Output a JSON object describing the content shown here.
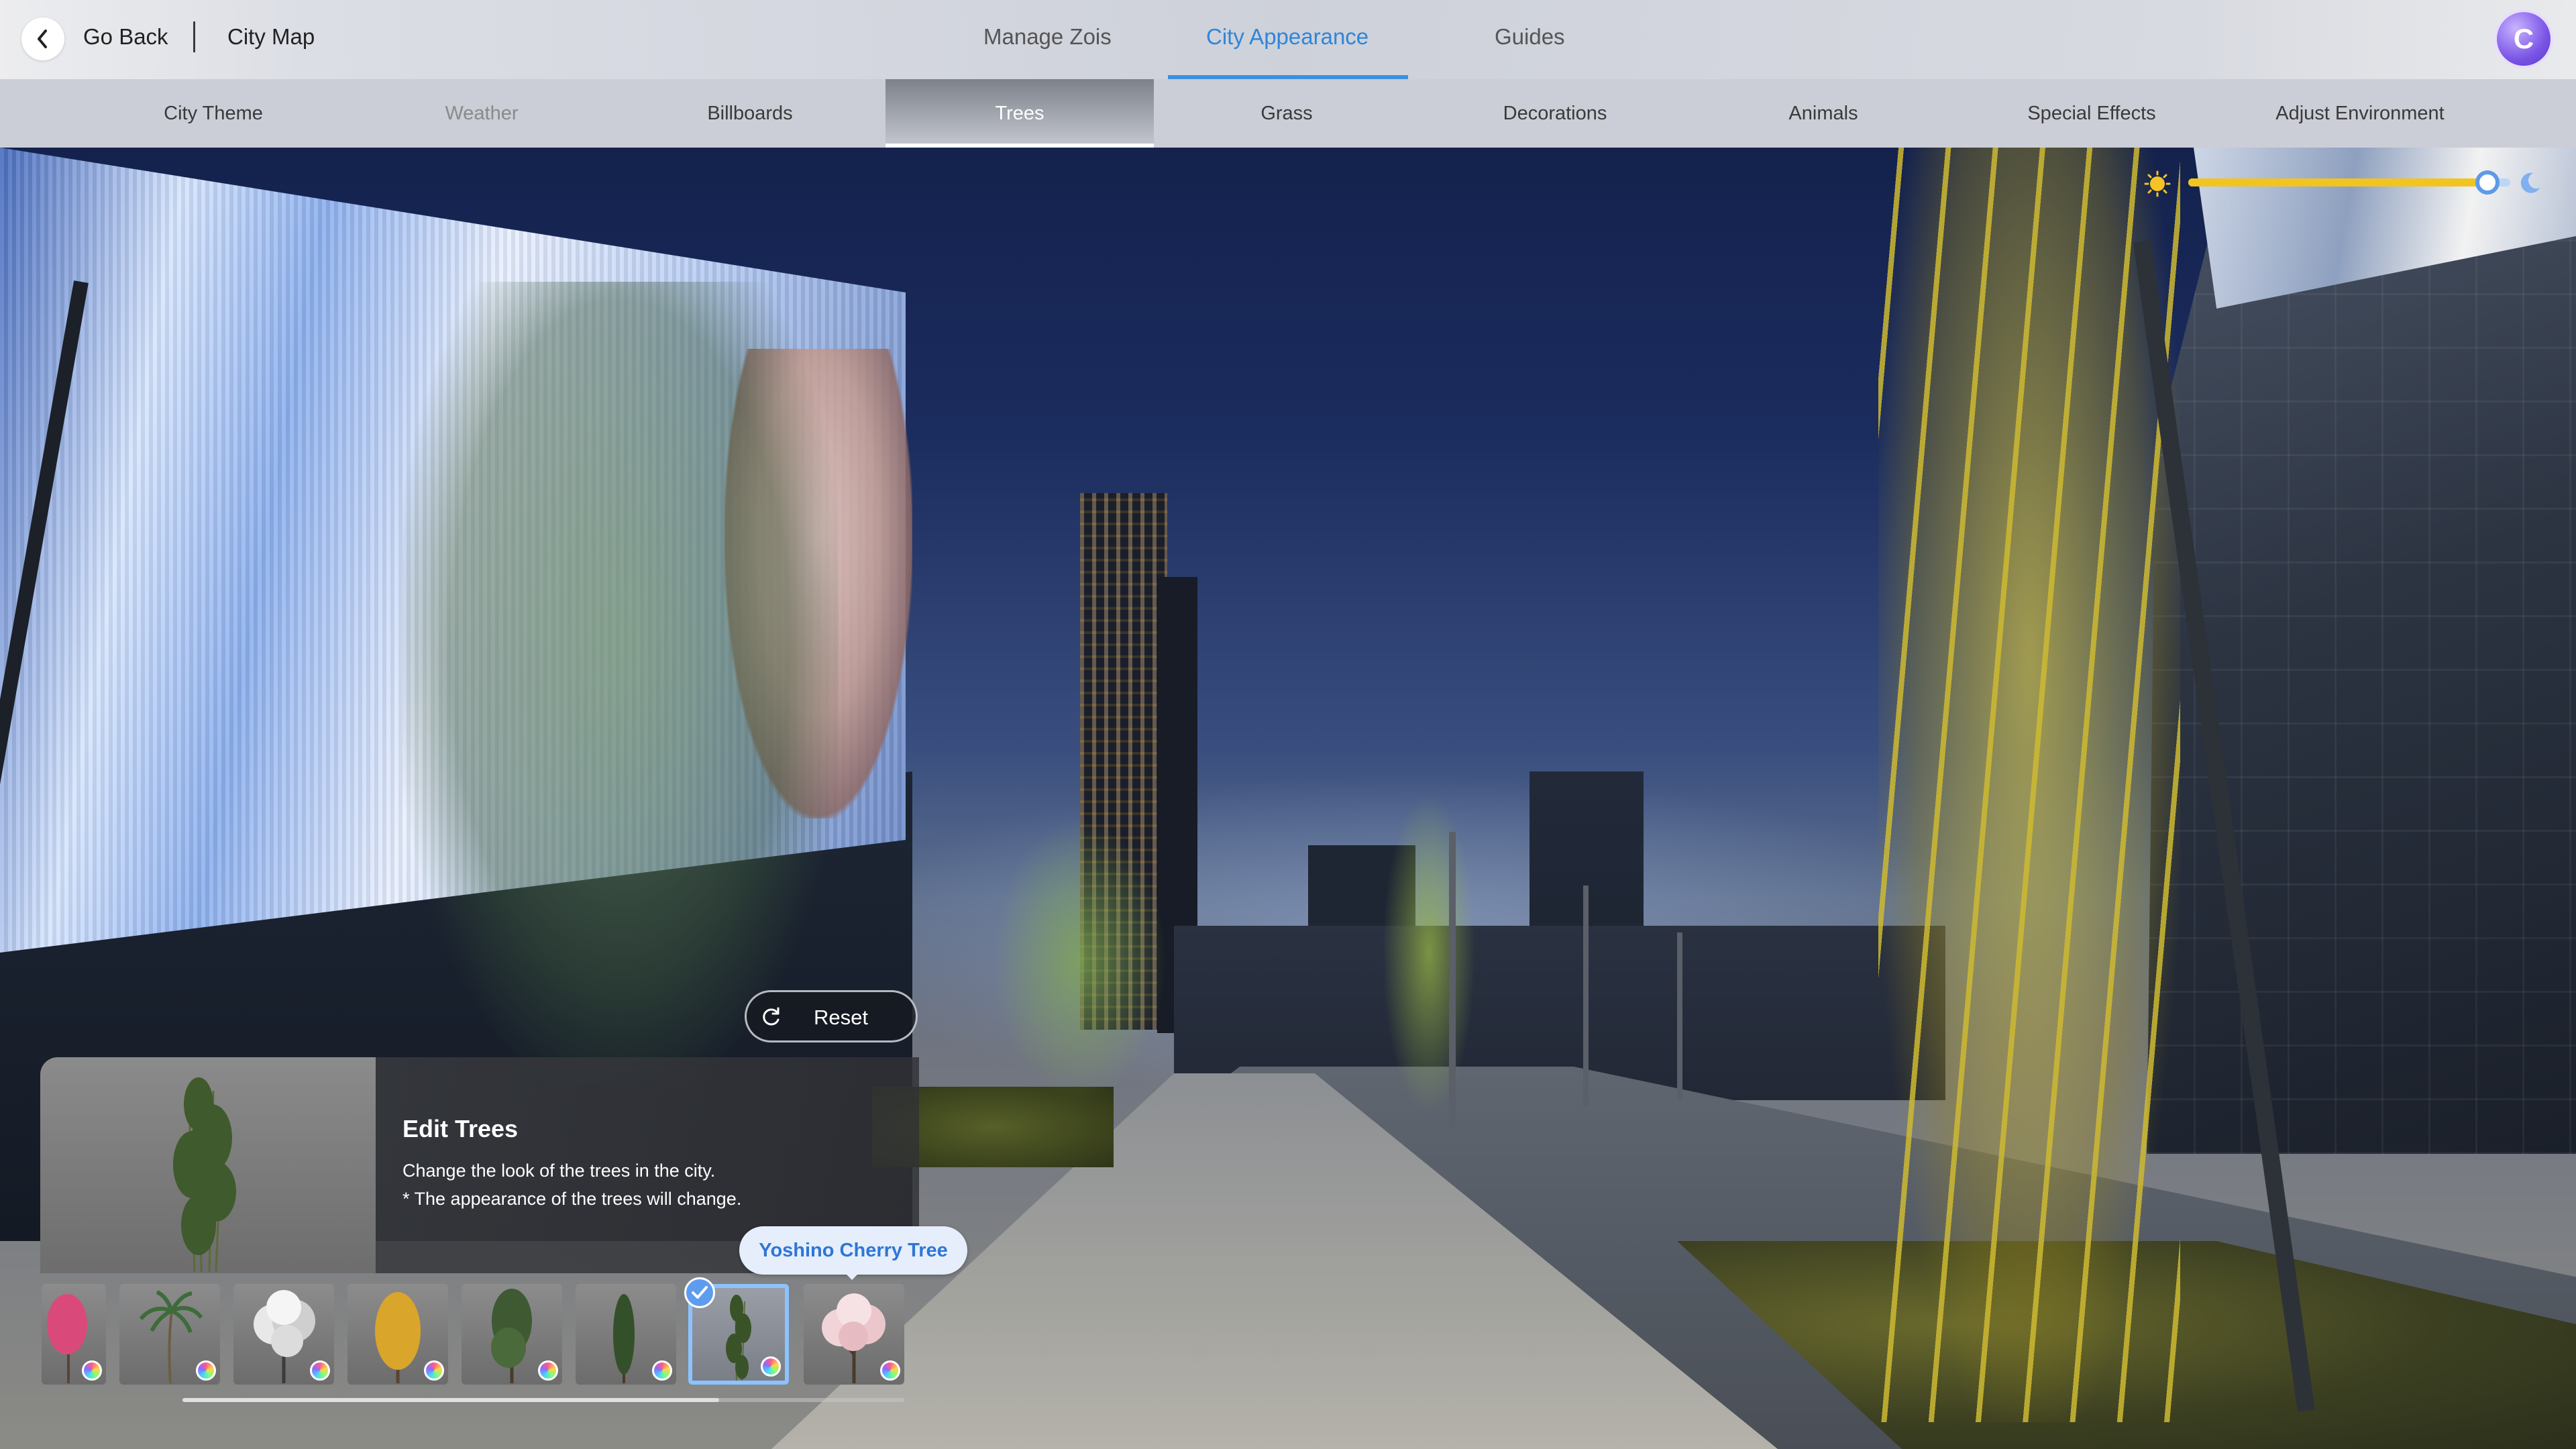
{
  "header": {
    "back_label": "Go Back",
    "breadcrumb": "City Map",
    "tabs": [
      {
        "label": "Manage Zois",
        "active": false
      },
      {
        "label": "City Appearance",
        "active": true
      },
      {
        "label": "Guides",
        "active": false
      }
    ],
    "avatar_letter": "C",
    "accent_color": "#2f86d8"
  },
  "subtabs": [
    {
      "label": "City Theme",
      "state": "normal"
    },
    {
      "label": "Weather",
      "state": "disabled"
    },
    {
      "label": "Billboards",
      "state": "normal"
    },
    {
      "label": "Trees",
      "state": "active"
    },
    {
      "label": "Grass",
      "state": "normal"
    },
    {
      "label": "Decorations",
      "state": "normal"
    },
    {
      "label": "Animals",
      "state": "normal"
    },
    {
      "label": "Special Effects",
      "state": "normal"
    },
    {
      "label": "Adjust Environment",
      "state": "normal"
    }
  ],
  "time_slider": {
    "left_icon": "sun-icon",
    "right_icon": "moon-icon",
    "value": 0.93
  },
  "reset": {
    "label": "Reset",
    "icon": "refresh-icon"
  },
  "edit_panel": {
    "title": "Edit Trees",
    "description_line1": "Change the look of the trees in the city.",
    "description_line2": "* The appearance of the trees will change."
  },
  "tooltip": {
    "label": "Yoshino Cherry Tree"
  },
  "tree_options": [
    {
      "kind": "pink-blossom-tree",
      "selected": false
    },
    {
      "kind": "palm-tree",
      "selected": false
    },
    {
      "kind": "white-leaf-tree",
      "selected": false
    },
    {
      "kind": "golden-ginkgo-tree",
      "selected": false
    },
    {
      "kind": "green-tree",
      "selected": false
    },
    {
      "kind": "cypress-tree",
      "selected": false
    },
    {
      "kind": "bamboo-tree",
      "selected": true
    },
    {
      "kind": "yoshino-cherry-tree",
      "selected": false
    }
  ],
  "colors": {
    "sun": "#f5c324",
    "slider_thumb": "#5d9ae8",
    "selected_border": "#8cc3ff",
    "tooltip_text": "#2f76d6"
  }
}
